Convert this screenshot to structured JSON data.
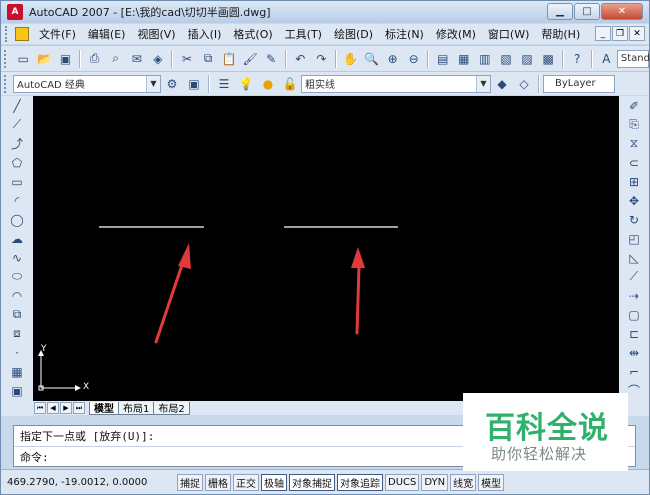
{
  "window": {
    "title": "AutoCAD 2007 - [E:\\我的cad\\切切半画圆.dwg]",
    "icon_text": "A",
    "controls": [
      "minimize",
      "maximize",
      "close"
    ],
    "mdi_controls": [
      "minimize",
      "restore",
      "close"
    ]
  },
  "menu": {
    "items": [
      "文件(F)",
      "编辑(E)",
      "视图(V)",
      "插入(I)",
      "格式(O)",
      "工具(T)",
      "绘图(D)",
      "标注(N)",
      "修改(M)",
      "窗口(W)",
      "帮助(H)"
    ]
  },
  "toolbar1": {
    "text_style_value": "Stand"
  },
  "toolbar2": {
    "workspace_value": "AutoCAD 经典",
    "linetype_value": "粗实线",
    "layer_color_value": "ByLayer"
  },
  "ucs": {
    "x_label": "X",
    "y_label": "Y"
  },
  "layout_tabs": [
    "模型",
    "布局1",
    "布局2"
  ],
  "command": {
    "history_line": "指定下一点或 [放弃(U)]:",
    "prompt_line": "命令:"
  },
  "status": {
    "coordinates": "469.2790, -19.0012, 0.0000",
    "buttons": [
      "捕捉",
      "栅格",
      "正交",
      "极轴",
      "对象捕捉",
      "对象追踪",
      "DUCS",
      "DYN",
      "线宽",
      "模型"
    ]
  },
  "watermark": {
    "title": "百科全说",
    "subtitle": "助你轻松解决"
  },
  "colors": {
    "canvas": "#000000",
    "line": "#ffffff",
    "arrow": "#e03a3a",
    "watermark_green": "#2fb06b"
  }
}
